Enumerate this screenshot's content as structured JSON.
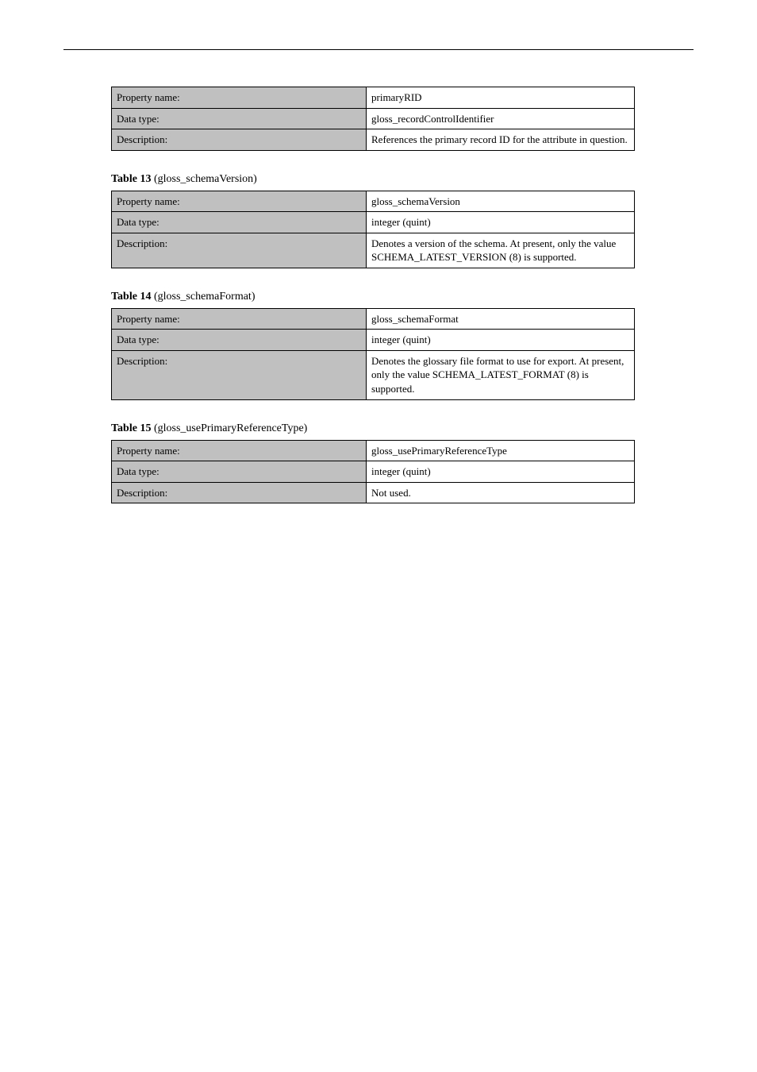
{
  "labels": {
    "propertyName": "Property name:",
    "dataType": "Data type:",
    "description": "Description:",
    "tableCaptionPrefix": "Table"
  },
  "properties": [
    {
      "caption": null,
      "rows": {
        "propertyName": "primaryRID",
        "dataType": "gloss_recordControlIdentifier",
        "description": "References the primary record ID for the attribute in question."
      }
    },
    {
      "caption": {
        "number": "13",
        "type": "gloss_schemaVersion"
      },
      "rows": {
        "propertyName": "gloss_schemaVersion",
        "dataType": "integer (quint)",
        "description": "Denotes a version of the schema. At present, only the value SCHEMA_LATEST_VERSION (8) is supported."
      }
    },
    {
      "caption": {
        "number": "14",
        "type": "gloss_schemaFormat"
      },
      "rows": {
        "propertyName": "gloss_schemaFormat",
        "dataType": "integer (quint)",
        "description": "Denotes the glossary file format to use for export. At present, only the value SCHEMA_LATEST_FORMAT (8) is supported."
      }
    },
    {
      "caption": {
        "number": "15",
        "type": "gloss_usePrimaryReferenceType"
      },
      "rows": {
        "propertyName": "gloss_usePrimaryReferenceType",
        "dataType": "integer (quint)",
        "description": "Not used."
      }
    }
  ]
}
